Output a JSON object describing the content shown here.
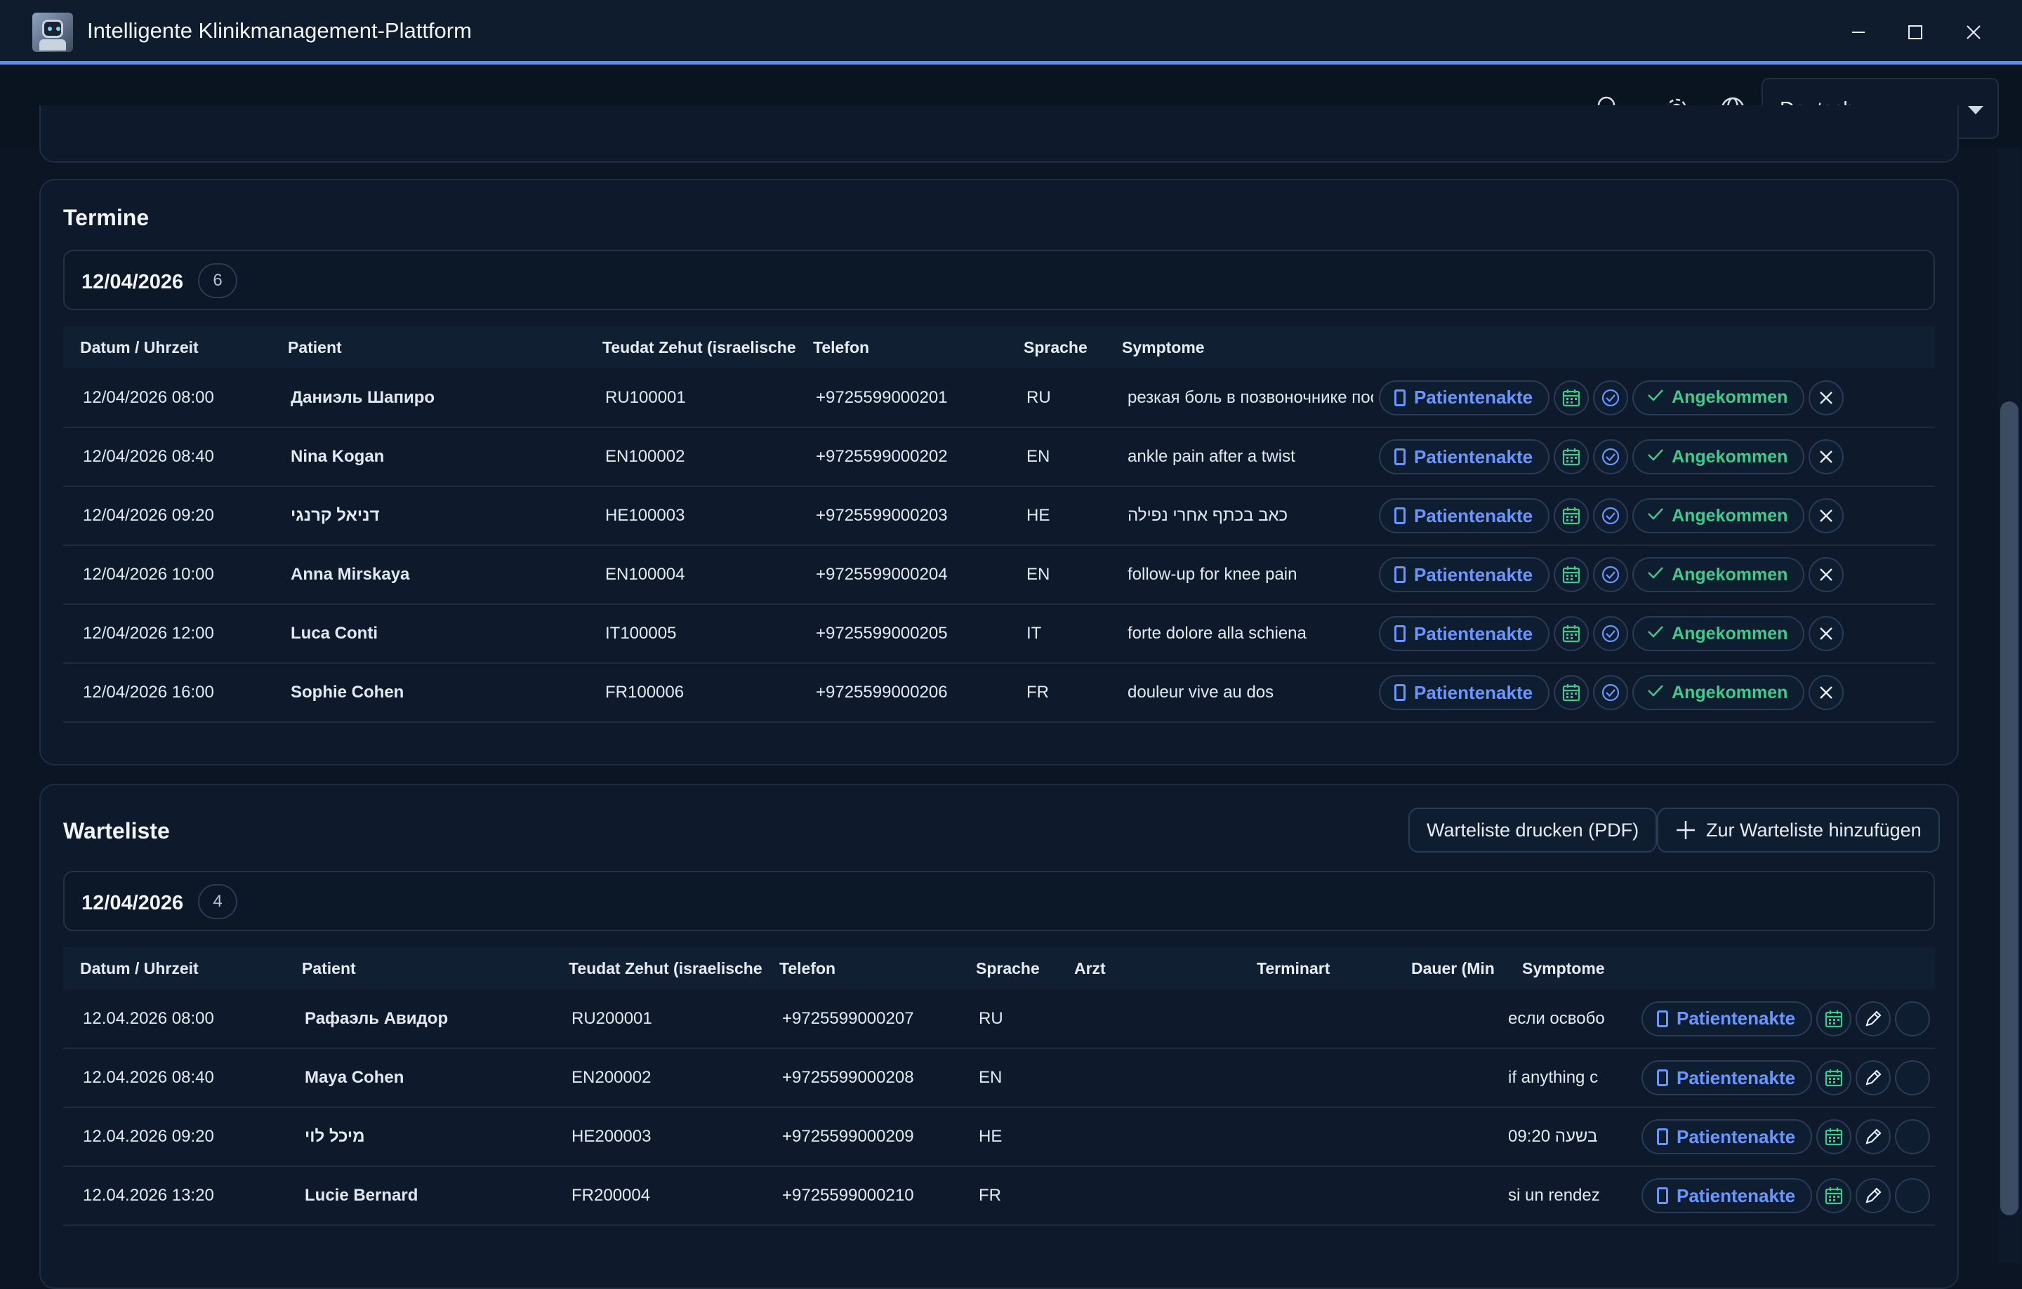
{
  "window": {
    "title": "Intelligente Klinikmanagement-Plattform",
    "icons": {
      "minimize": "minimize-icon",
      "maximize": "maximize-icon",
      "close": "close-icon"
    }
  },
  "toolbar": {
    "language": "Deutsch",
    "icons": {
      "search": "search-icon",
      "settings": "gear-icon",
      "language": "globe-icon"
    }
  },
  "appointments": {
    "title": "Termine",
    "date": "12/04/2026",
    "count": "6",
    "columns": [
      "Datum / Uhrzeit",
      "Patient",
      "Teudat Zehut (israelische",
      "Telefon",
      "Sprache",
      "Symptome"
    ],
    "record_label": "Patientenakte",
    "arrived_label": "Angekommen",
    "rows": [
      {
        "datetime": "12/04/2026 08:00",
        "patient": "Даниэль Шапиро",
        "id": "RU100001",
        "phone": "+9725599000201",
        "lang": "RU",
        "symptoms": "резкая боль в позвоночнике после падения"
      },
      {
        "datetime": "12/04/2026 08:40",
        "patient": "Nina Kogan",
        "id": "EN100002",
        "phone": "+9725599000202",
        "lang": "EN",
        "symptoms": "ankle pain after a twist"
      },
      {
        "datetime": "12/04/2026 09:20",
        "patient": "דניאל קרנגי",
        "id": "HE100003",
        "phone": "+9725599000203",
        "lang": "HE",
        "symptoms": "כאב בכתף אחרי נפילה"
      },
      {
        "datetime": "12/04/2026 10:00",
        "patient": "Anna Mirskaya",
        "id": "EN100004",
        "phone": "+9725599000204",
        "lang": "EN",
        "symptoms": "follow-up for knee pain"
      },
      {
        "datetime": "12/04/2026 12:00",
        "patient": "Luca Conti",
        "id": "IT100005",
        "phone": "+9725599000205",
        "lang": "IT",
        "symptoms": "forte dolore alla schiena"
      },
      {
        "datetime": "12/04/2026 16:00",
        "patient": "Sophie Cohen",
        "id": "FR100006",
        "phone": "+9725599000206",
        "lang": "FR",
        "symptoms": "douleur vive au dos"
      }
    ]
  },
  "waitlist": {
    "title": "Warteliste",
    "print_label": "Warteliste drucken (PDF)",
    "add_label": "Zur Warteliste hinzufügen",
    "date": "12/04/2026",
    "count": "4",
    "columns": [
      "Datum / Uhrzeit",
      "Patient",
      "Teudat Zehut (israelische",
      "Telefon",
      "Sprache",
      "Arzt",
      "Terminart",
      "Dauer (Min",
      "Symptome"
    ],
    "record_label": "Patientenakte",
    "rows": [
      {
        "datetime": "12.04.2026 08:00",
        "patient": "Рафаэль Авидор",
        "id": "RU200001",
        "phone": "+9725599000207",
        "lang": "RU",
        "doctor": "",
        "type": "",
        "duration": "",
        "symptoms": "если освобо"
      },
      {
        "datetime": "12.04.2026 08:40",
        "patient": "Maya Cohen",
        "id": "EN200002",
        "phone": "+9725599000208",
        "lang": "EN",
        "doctor": "",
        "type": "",
        "duration": "",
        "symptoms": "if anything c"
      },
      {
        "datetime": "12.04.2026 09:20",
        "patient": "מיכל לוי",
        "id": "HE200003",
        "phone": "+9725599000209",
        "lang": "HE",
        "doctor": "",
        "type": "",
        "duration": "",
        "symptoms": "בשעה 09:20"
      },
      {
        "datetime": "12.04.2026 13:20",
        "patient": "Lucie Bernard",
        "id": "FR200004",
        "phone": "+9725599000210",
        "lang": "FR",
        "doctor": "",
        "type": "",
        "duration": "",
        "symptoms": "si un rendez"
      }
    ]
  },
  "colors": {
    "accent": "#5b8ff5",
    "link": "#6a97ff",
    "success": "#3fcb8a",
    "background": "#0b1524",
    "card": "#0e1a2b"
  }
}
